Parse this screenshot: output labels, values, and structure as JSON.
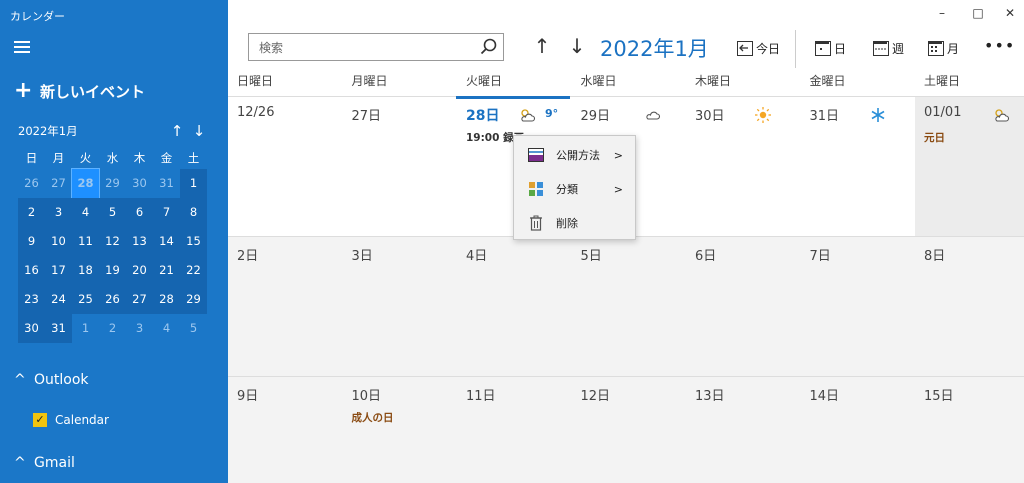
{
  "app": {
    "title": "カレンダー"
  },
  "window": {
    "minimize": "–",
    "maximize": "□",
    "close": "✕"
  },
  "sidebar": {
    "new_event": "新しいイベント",
    "mini_calendar": {
      "month_label": "2022年1月",
      "dow": [
        "日",
        "月",
        "火",
        "水",
        "木",
        "金",
        "土"
      ],
      "days": [
        "26",
        "27",
        "28",
        "29",
        "30",
        "31",
        "1",
        "2",
        "3",
        "4",
        "5",
        "6",
        "7",
        "8",
        "9",
        "10",
        "11",
        "12",
        "13",
        "14",
        "15",
        "16",
        "17",
        "18",
        "19",
        "20",
        "21",
        "22",
        "23",
        "24",
        "25",
        "26",
        "27",
        "28",
        "29",
        "30",
        "31",
        "1",
        "2",
        "3",
        "4",
        "5"
      ]
    },
    "groups": {
      "outlook": "Outlook",
      "calendar_item": "Calendar",
      "gmail": "Gmail"
    }
  },
  "toolbar": {
    "search_placeholder": "検索",
    "period_label": "2022年1月",
    "today": "今日",
    "day": "日",
    "week": "週",
    "month": "月",
    "more": "•••"
  },
  "weekdays": [
    "日曜日",
    "月曜日",
    "火曜日",
    "水曜日",
    "木曜日",
    "金曜日",
    "土曜日"
  ],
  "weeks": [
    {
      "days": [
        "12/26",
        "27日",
        "28日",
        "29日",
        "30日",
        "31日",
        "01/01"
      ],
      "event_28": "19:00 録画",
      "temp_28": "9°",
      "holiday_0101": "元日"
    },
    {
      "days": [
        "2日",
        "3日",
        "4日",
        "5日",
        "6日",
        "7日",
        "8日"
      ]
    },
    {
      "days": [
        "9日",
        "10日",
        "11日",
        "12日",
        "13日",
        "14日",
        "15日"
      ],
      "holiday_10": "成人の日"
    }
  ],
  "context_menu": {
    "items": [
      {
        "label": "公開方法",
        "icon": "publish-icon"
      },
      {
        "label": "分類",
        "icon": "categorize-icon"
      },
      {
        "label": "削除",
        "icon": "trash-icon"
      }
    ]
  },
  "colors": {
    "sidebar": "#1b77c8",
    "accent": "#1b72c2",
    "holiday": "#8a4b12"
  }
}
